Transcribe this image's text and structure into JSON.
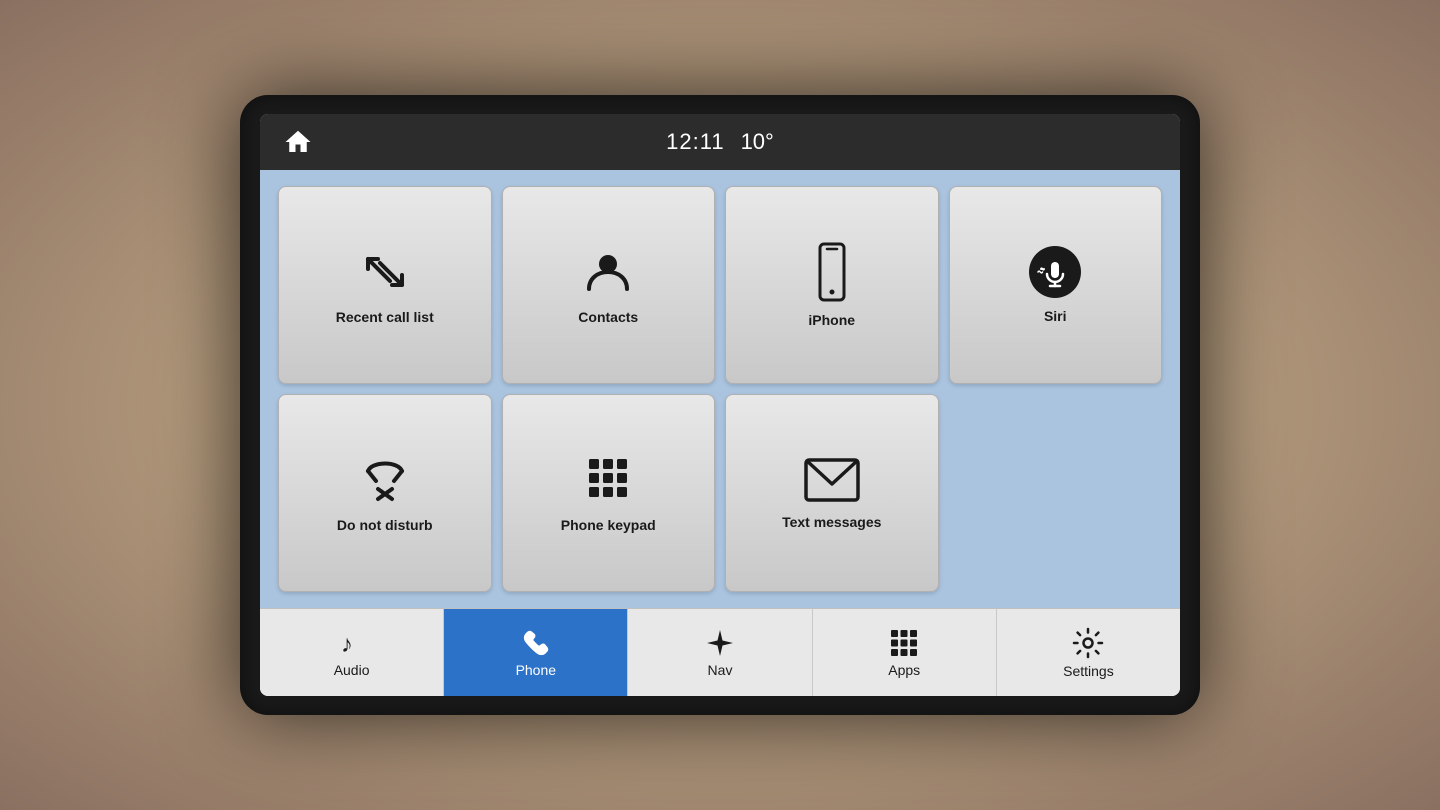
{
  "header": {
    "time": "12:11",
    "temp": "10°",
    "home_label": "home"
  },
  "grid_buttons": [
    {
      "id": "recent-call-list",
      "label": "Recent call list",
      "icon": "recent-calls"
    },
    {
      "id": "contacts",
      "label": "Contacts",
      "icon": "contacts"
    },
    {
      "id": "iphone",
      "label": "iPhone",
      "icon": "iphone"
    },
    {
      "id": "siri",
      "label": "Siri",
      "icon": "siri"
    },
    {
      "id": "do-not-disturb",
      "label": "Do not disturb",
      "icon": "do-not-disturb"
    },
    {
      "id": "phone-keypad",
      "label": "Phone keypad",
      "icon": "keypad"
    },
    {
      "id": "text-messages",
      "label": "Text messages",
      "icon": "messages"
    }
  ],
  "nav_items": [
    {
      "id": "audio",
      "label": "Audio",
      "icon": "music-note",
      "active": false
    },
    {
      "id": "phone",
      "label": "Phone",
      "icon": "phone",
      "active": true
    },
    {
      "id": "nav",
      "label": "Nav",
      "icon": "compass",
      "active": false
    },
    {
      "id": "apps",
      "label": "Apps",
      "icon": "apps-grid",
      "active": false
    },
    {
      "id": "settings",
      "label": "Settings",
      "icon": "gear",
      "active": false
    }
  ]
}
